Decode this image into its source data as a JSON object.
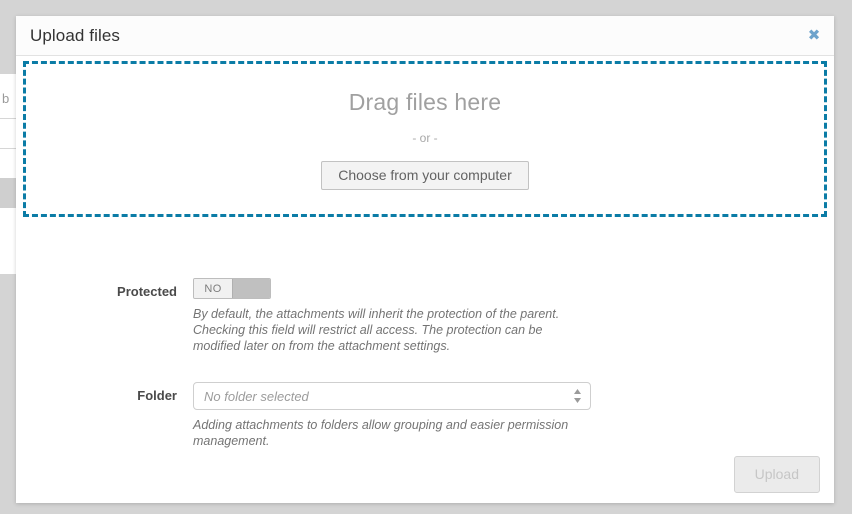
{
  "modal": {
    "title": "Upload files",
    "close_icon": "close-x-icon",
    "close_label": "✖",
    "accent_color": "#0b7ca6",
    "close_color": "#6da3cc"
  },
  "dropzone": {
    "title": "Drag files here",
    "separator": "- or -",
    "browse_label": "Choose from your computer",
    "border_color": "#0b7ca6"
  },
  "form": {
    "protected": {
      "label": "Protected",
      "toggle_value": "NO",
      "help": "By default, the attachments will inherit the protection of the parent. Checking this field will restrict all access. The protection can be modified later on from the attachment settings."
    },
    "folder": {
      "label": "Folder",
      "selected": "No folder selected",
      "help": "Adding attachments to folders allow grouping and easier permission management.",
      "stepper_icon": "up-down-arrows-icon"
    }
  },
  "footer": {
    "upload_label": "Upload"
  },
  "background": {
    "letter": "b"
  }
}
